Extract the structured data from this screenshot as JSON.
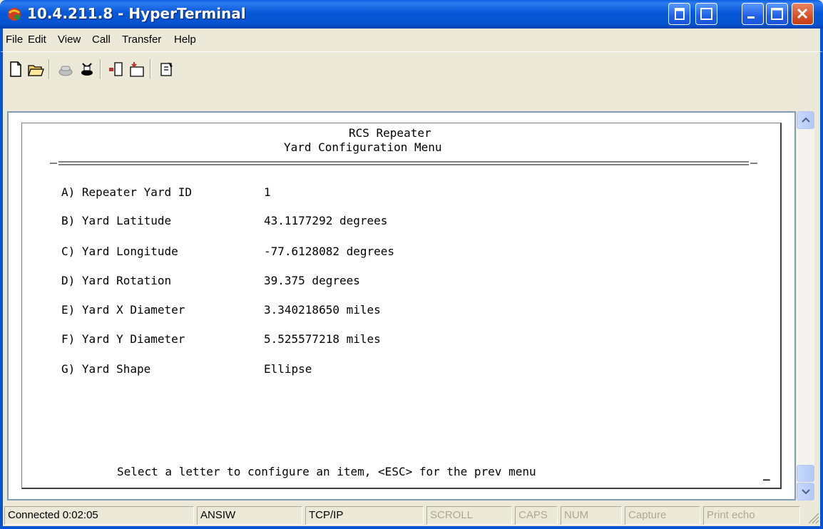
{
  "window": {
    "title": "10.4.211.8 - HyperTerminal"
  },
  "menu": [
    "File",
    "Edit",
    "View",
    "Call",
    "Transfer",
    "Help"
  ],
  "toolbar_icons": [
    "new-document-icon",
    "open-folder-icon",
    "call-icon",
    "disconnect-icon",
    "send-icon",
    "receive-icon",
    "properties-icon"
  ],
  "terminal": {
    "header_line1": "RCS Repeater",
    "header_line2": "Yard Configuration Menu",
    "items": [
      {
        "label": "A) Repeater Yard ID",
        "value": "1"
      },
      {
        "label": "B) Yard Latitude",
        "value": "43.1177292 degrees"
      },
      {
        "label": "C) Yard Longitude",
        "value": "-77.6128082 degrees"
      },
      {
        "label": "D) Yard Rotation",
        "value": "39.375 degrees"
      },
      {
        "label": "E) Yard X Diameter",
        "value": "3.340218650 miles"
      },
      {
        "label": "F) Yard Y Diameter",
        "value": "5.525577218 miles"
      },
      {
        "label": "G) Yard Shape",
        "value": "Ellipse"
      }
    ],
    "prompt": "Select a letter to configure an item, <ESC> for the prev menu",
    "cursor": "_"
  },
  "status": {
    "connected": "Connected 0:02:05",
    "emulation": "ANSIW",
    "protocol": "TCP/IP",
    "scroll": "SCROLL",
    "caps": "CAPS",
    "num": "NUM",
    "capture": "Capture",
    "print_echo": "Print echo"
  },
  "colors": {
    "titlebar": "#0453D0",
    "chrome": "#ECE9D8",
    "close": "#D8532A"
  }
}
